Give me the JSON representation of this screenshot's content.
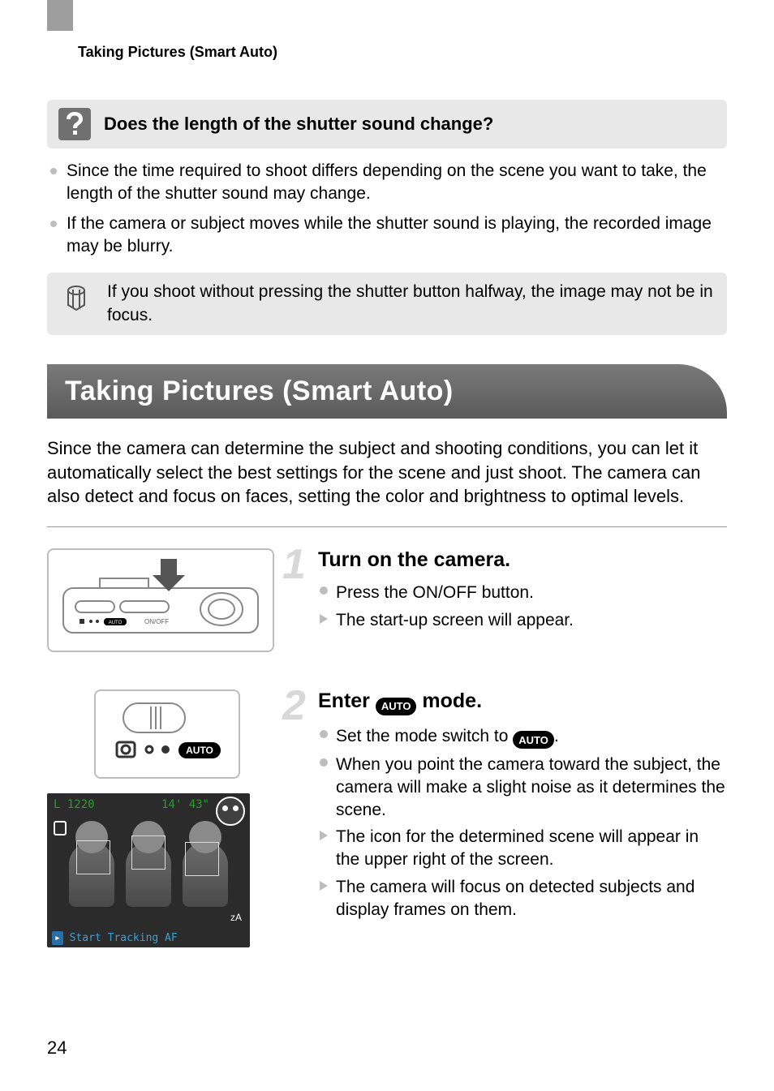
{
  "header": "Taking Pictures (Smart Auto)",
  "question": {
    "title": "Does the length of the shutter sound change?",
    "bullets": [
      "Since the time required to shoot differs depending on the scene you want to take, the length of the shutter sound may change.",
      "If the camera or subject moves while the shutter sound is playing, the recorded image may be blurry."
    ]
  },
  "note": "If you shoot without pressing the shutter button halfway, the image may not be in focus.",
  "title_bar": "Taking Pictures (Smart Auto)",
  "intro": "Since the camera can determine the subject and shooting conditions, you can let it automatically select the best settings for the scene and just shoot. The camera can also detect and focus on faces, setting the color and brightness to optimal levels.",
  "auto_label": "AUTO",
  "steps": [
    {
      "number": "1",
      "title": "Turn on the camera.",
      "lines": [
        {
          "type": "circle",
          "text": "Press the ON/OFF button."
        },
        {
          "type": "tri",
          "text": "The start-up screen will appear."
        }
      ]
    },
    {
      "number": "2",
      "title_prefix": "Enter ",
      "title_suffix": " mode.",
      "lines": [
        {
          "type": "circle",
          "text_prefix": "Set the mode switch to ",
          "text_suffix": "."
        },
        {
          "type": "circle",
          "text": "When you point the camera toward the subject, the camera will make a slight noise as it determines the scene."
        },
        {
          "type": "tri",
          "text": "The icon for the determined scene will appear in the upper right of the screen."
        },
        {
          "type": "tri",
          "text": "The camera will focus on detected subjects and display frames on them."
        }
      ]
    }
  ],
  "screenshot": {
    "line1": "     L 1220",
    "line2": "14' 43\"",
    "bottom": "Start Tracking AF",
    "za": "zA"
  },
  "camera_labels": {
    "onoff": "ON/OFF"
  },
  "page_number": "24"
}
